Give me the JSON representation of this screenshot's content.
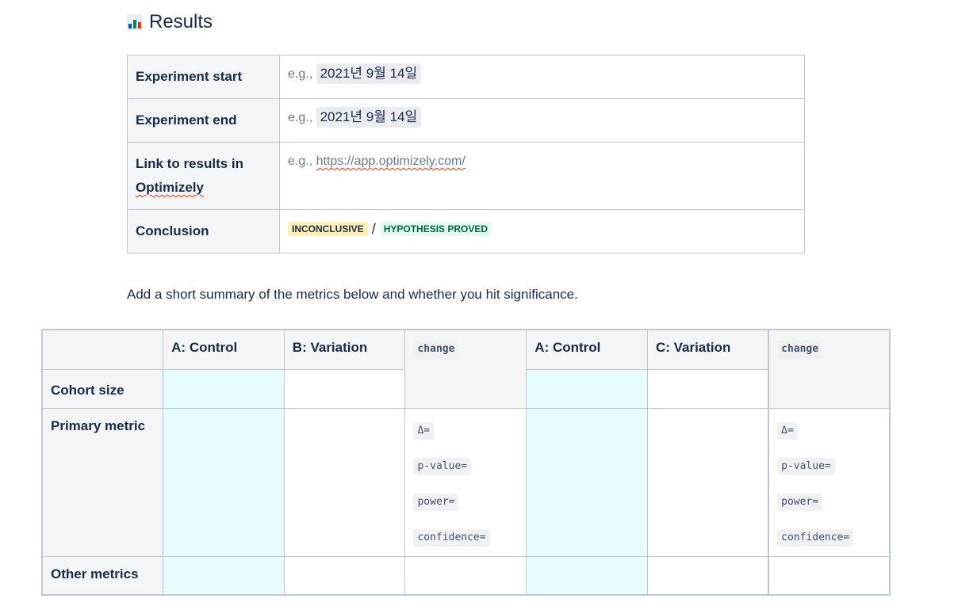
{
  "heading": {
    "icon": "bar-chart-icon",
    "title": "Results"
  },
  "info": {
    "rows": [
      {
        "label": "Experiment start",
        "prefix": "e.g.,",
        "date": "2021년 9월 14일"
      },
      {
        "label": "Experiment end",
        "prefix": "e.g.,",
        "date": "2021년 9월 14일"
      },
      {
        "label_line1": "Link to results in",
        "label_line2": "Optimizely",
        "prefix": "e.g.,",
        "link": "https://app.optimizely.com/"
      },
      {
        "label": "Conclusion",
        "status1": "INCONCLUSIVE",
        "separator": "/",
        "status2": "HYPOTHESIS PROVED"
      }
    ]
  },
  "summary": "Add a short summary of the metrics below and whether you hit significance.",
  "metrics": {
    "headers": [
      "A: Control",
      "B: Variation",
      "change",
      "A: Control",
      "C: Variation",
      "change"
    ],
    "row_labels": [
      "Cohort size",
      "Primary metric",
      "Other metrics"
    ],
    "stats": [
      "Δ=",
      "p-value=",
      "power=",
      "confidence="
    ]
  },
  "colors": {
    "header_bg": "#f4f5f7",
    "control_bg": "#e6fcff",
    "border": "#c1c7d0",
    "inconclusive": "#fff0b3",
    "proved": "#e3fcef"
  }
}
